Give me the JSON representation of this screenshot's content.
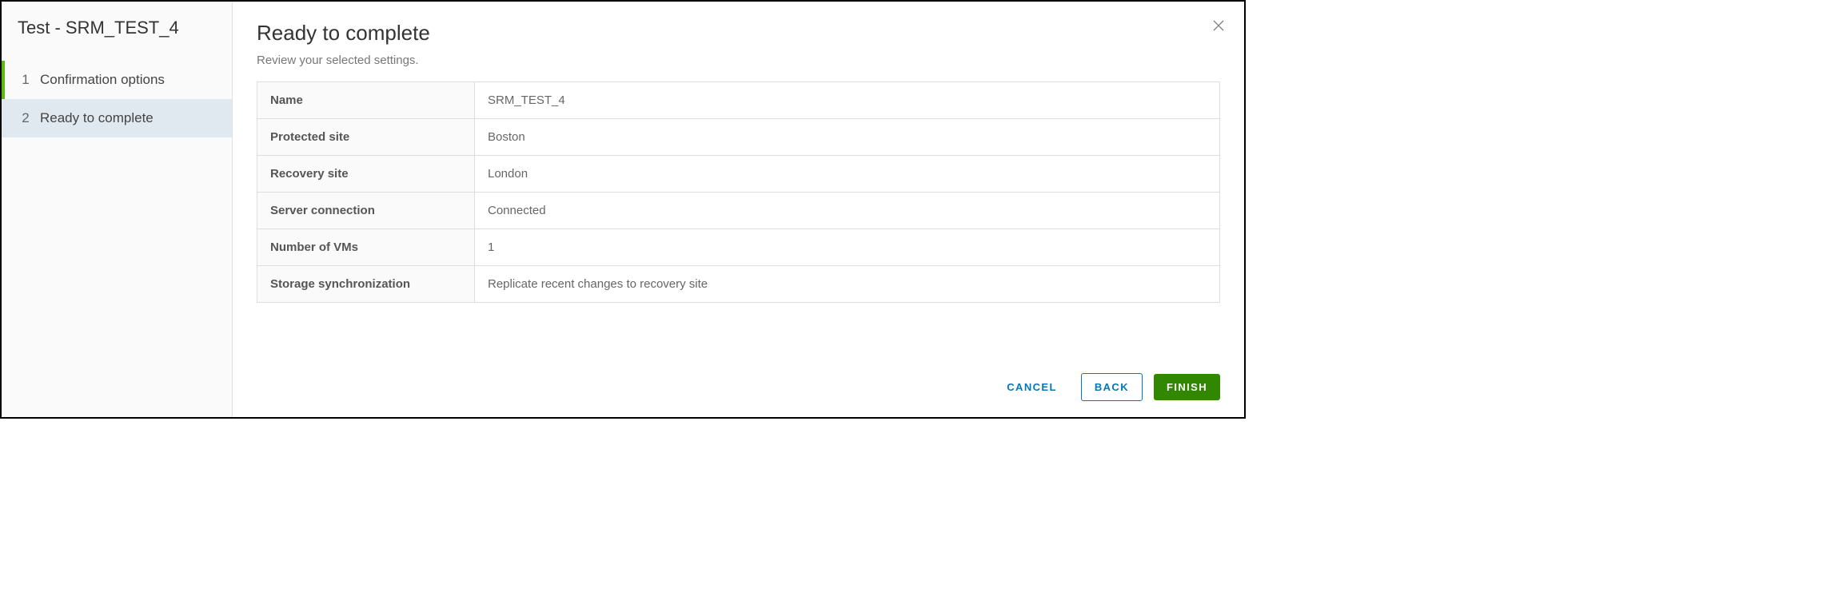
{
  "sidebar": {
    "title": "Test - SRM_TEST_4",
    "steps": [
      {
        "number": "1",
        "label": "Confirmation options"
      },
      {
        "number": "2",
        "label": "Ready to complete"
      }
    ]
  },
  "content": {
    "title": "Ready to complete",
    "subtitle": "Review your selected settings."
  },
  "summary": [
    {
      "key": "Name",
      "value": "SRM_TEST_4"
    },
    {
      "key": "Protected site",
      "value": "Boston"
    },
    {
      "key": "Recovery site",
      "value": "London"
    },
    {
      "key": "Server connection",
      "value": "Connected"
    },
    {
      "key": "Number of VMs",
      "value": "1"
    },
    {
      "key": "Storage synchronization",
      "value": "Replicate recent changes to recovery site"
    }
  ],
  "actions": {
    "cancel": "Cancel",
    "back": "Back",
    "finish": "Finish"
  }
}
